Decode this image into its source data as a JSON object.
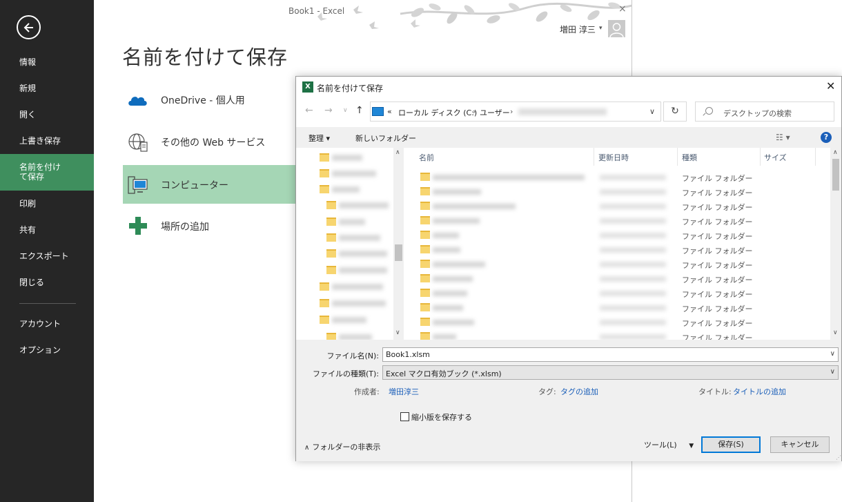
{
  "window": {
    "title": "Book1 - Excel"
  },
  "user": {
    "name": "増田 淳三"
  },
  "sidebar": {
    "items": [
      {
        "label": "情報"
      },
      {
        "label": "新規"
      },
      {
        "label": "開く"
      },
      {
        "label": "上書き保存"
      },
      {
        "label": "名前を付けて保存",
        "active": true
      },
      {
        "label": "印刷"
      },
      {
        "label": "共有"
      },
      {
        "label": "エクスポート"
      },
      {
        "label": "閉じる"
      },
      {
        "label": "アカウント"
      },
      {
        "label": "オプション"
      }
    ]
  },
  "backstage": {
    "title": "名前を付けて保存",
    "places": [
      {
        "label": "OneDrive - 個人用",
        "icon": "cloud-icon"
      },
      {
        "label": "その他の Web サービス",
        "icon": "globe-icon"
      },
      {
        "label": "コンピューター",
        "icon": "computer-icon",
        "selected": true
      },
      {
        "label": "場所の追加",
        "icon": "plus-icon"
      }
    ]
  },
  "dialog": {
    "title": "名前を付けて保存",
    "address": {
      "prefix": "«",
      "segments": [
        "ローカル ディスク (C:)",
        "ユーザー"
      ]
    },
    "search_placeholder": "デスクトップの検索",
    "toolbar": {
      "organize": "整理 ▾",
      "new_folder": "新しいフォルダー"
    },
    "columns": [
      "名前",
      "更新日時",
      "種類",
      "サイズ"
    ],
    "rows": [
      {
        "type": "ファイル フォルダー"
      },
      {
        "type": "ファイル フォルダー"
      },
      {
        "type": "ファイル フォルダー"
      },
      {
        "type": "ファイル フォルダー"
      },
      {
        "type": "ファイル フォルダー"
      },
      {
        "type": "ファイル フォルダー"
      },
      {
        "type": "ファイル フォルダー"
      },
      {
        "type": "ファイル フォルダー"
      },
      {
        "type": "ファイル フォルダー"
      },
      {
        "type": "ファイル フォルダー"
      },
      {
        "type": "ファイル フォルダー"
      },
      {
        "type": "ファイル フォルダー"
      }
    ],
    "filename_label": "ファイル名(N):",
    "filename_value": "Book1.xlsm",
    "filetype_label": "ファイルの種類(T):",
    "filetype_value": "Excel マクロ有効ブック (*.xlsm)",
    "author_label": "作成者:",
    "author_value": "増田淳三",
    "tag_label": "タグ:",
    "tag_value": "タグの追加",
    "title_label": "タイトル:",
    "title_value": "タイトルの追加",
    "thumbnail_label": "縮小版を保存する",
    "hide_folders": "フォルダーの非表示",
    "tools": "ツール(L)",
    "save": "保存(S)",
    "cancel": "キャンセル"
  }
}
